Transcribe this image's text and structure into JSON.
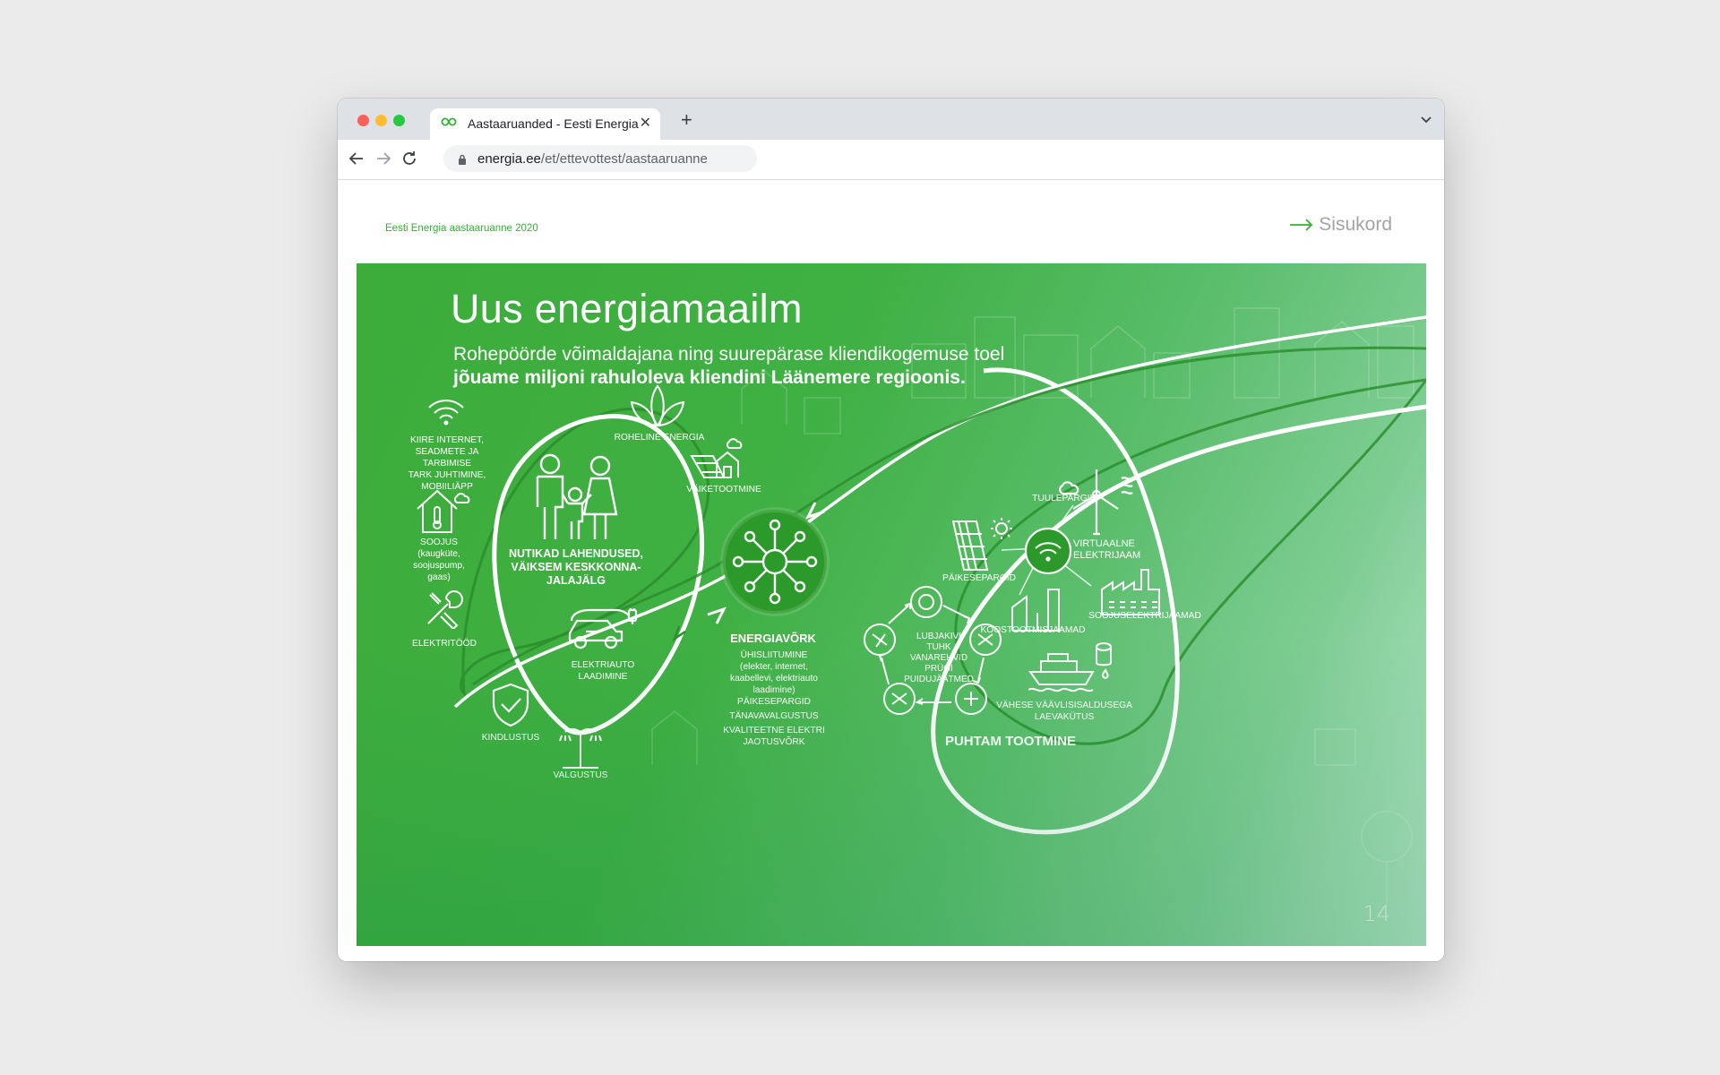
{
  "browser": {
    "tab_title": "Aastaaruanded - Eesti Energia",
    "new_tab": "+",
    "close": "✕",
    "url_host": "energia.ee",
    "url_path": "/et/ettevottest/aastaaruanne"
  },
  "page": {
    "doc_title": "Eesti Energia aastaaruanne 2020",
    "toc_label": "Sisukord",
    "page_number": "14"
  },
  "banner": {
    "title": "Uus energiamaailm",
    "subtitle_line1": "Rohepöörde võimaldajana ning suurepärase kliendikogemuse toel",
    "subtitle_line2": "jõuame miljoni rahuloleva kliendini Läänemere regioonis.",
    "left": {
      "internet": "KIIRE INTERNET,\nSEADMETE JA TARBIMISE\nTARK JUHTIMINE,\nMOBIILIÄPP",
      "heat": "SOOJUS\n(kaugküte,\nsoojuspump,\ngaas)",
      "electrical": "ELEKTRITÖÖD",
      "insurance": "KINDLUSTUS",
      "lighting": "VALGUSTUS",
      "green_energy": "ROHELINE ENERGIA",
      "small_production": "VÄIKETOOTMINE",
      "smart_solutions": "NUTIKAD LAHENDUSED,\nVÄIKSEM KESKKONNA-\nJALAJÄLG",
      "ev_charging": "ELEKTRIAUTO\nLAADIMINE"
    },
    "center": {
      "grid_title": "ENERGIAVÕRK",
      "grid_items": "ÜHISLIITUMINE\n(elekter, internet,\nkaabellevi, elektriauto\nlaadimine)",
      "solar_parks": "PÄIKESEPARGID",
      "street_lighting": "TÄNAVAVALGUSTUS",
      "quality": "KVALITEETNE ELEKTRI\nJAOTUSVÕRK"
    },
    "right": {
      "wind_parks": "TUULEPARGID",
      "virtual_plant": "VIRTUAALNE\nELEKTRIJAAM",
      "solar_parks": "PÄIKESEPARGID",
      "cogeneration": "KOOSTOOTMISJAAMAD",
      "heat_plants": "SOOJUSELEKTRIJAAMAD",
      "circular": "LUBJAKIVI\nTUHK\nVANAREHVID\nPRÜGI\nPUIDUJÄÄTMED",
      "shipping": "VÄHESE VÄÄVLISISALDUSEGA\nLAEVAKÜTUS",
      "clean_production": "PUHTAM TOOTMINE"
    }
  },
  "colors": {
    "accent_green": "#34b233",
    "banner_green": "#3fb043",
    "hub_green": "#2c9a2a"
  }
}
